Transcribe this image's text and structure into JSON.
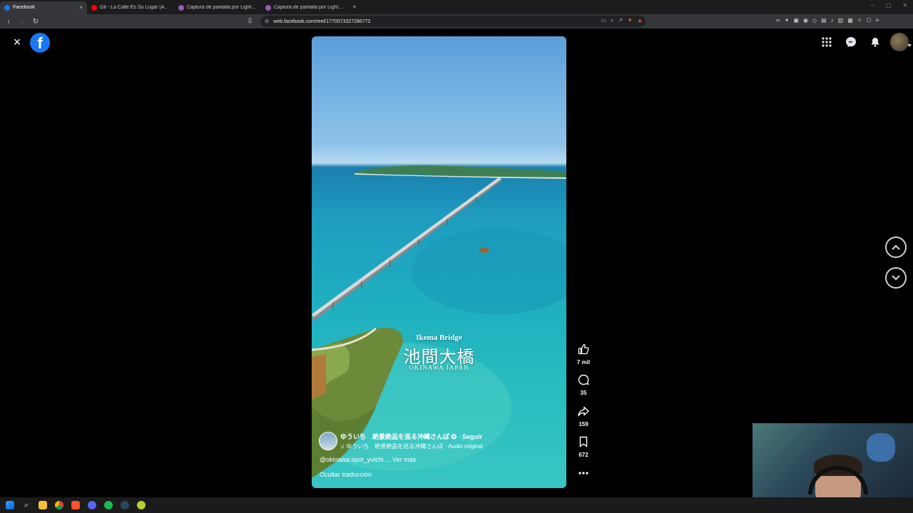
{
  "browser": {
    "tabs": [
      {
        "label": "Facebook",
        "active": true,
        "favicon_color": "#1877f2"
      },
      {
        "label": "Git - La Calle Es Su Lugar (Audio) - Y",
        "active": false,
        "favicon_color": "#ff0000"
      },
      {
        "label": "Captura de pantalla por Lightshot",
        "active": false,
        "favicon_color": "#9b59b6"
      },
      {
        "label": "Captura de pantalla por Lightshot",
        "active": false,
        "favicon_color": "#9b59b6"
      }
    ],
    "url": "web.facebook.com/reel/1770073327286772"
  },
  "reel": {
    "overlay_en": "Ikema Bridge",
    "overlay_jp": "池間大橋",
    "overlay_sub": "OKINAWA JAPAN",
    "author": "ゆういち　絶景絶品を巡る沖縄さんぽ",
    "follow": "Seguir",
    "audio": "ゆういち　絶景絶品を巡る沖縄さんぽ · Audio original",
    "caption": "@okinawa.spot_yuichi ... Ver más",
    "translate": "Ocultar traducción"
  },
  "actions": {
    "likes": "7 mil",
    "comments": "35",
    "shares": "159",
    "saves": "672"
  },
  "colors": {
    "facebook_blue": "#1877f2"
  },
  "icons": {
    "close": "×",
    "fb": "f",
    "menu": "⋮⋮",
    "up": "⌃",
    "down": "⌄"
  }
}
